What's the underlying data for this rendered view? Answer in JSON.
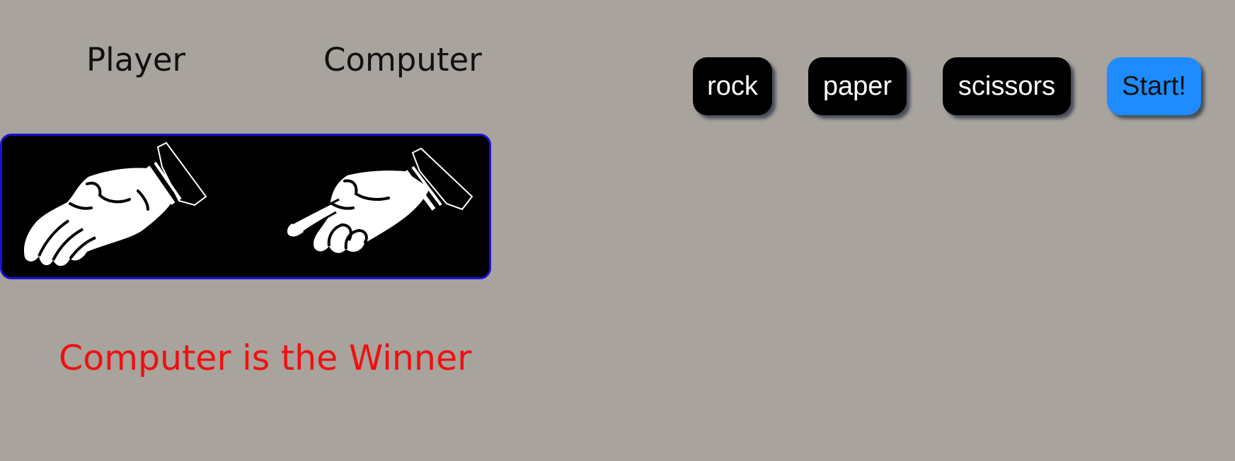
{
  "scoreboard": {
    "player_label": "Player",
    "computer_label": "Computer"
  },
  "hands": {
    "player_choice": "paper",
    "computer_choice": "scissors",
    "player_icon": "paper-hand-icon",
    "computer_icon": "scissors-hand-icon"
  },
  "result": {
    "text": "Computer is the Winner"
  },
  "controls": {
    "rock_label": "rock",
    "paper_label": "paper",
    "scissors_label": "scissors",
    "start_label": "Start!"
  },
  "colors": {
    "background": "#a8a39c",
    "arena": "#000000",
    "arena_border": "#1a12d6",
    "result_text": "#ee1111",
    "choice_button": "#000000",
    "start_button": "#1e8cff"
  }
}
